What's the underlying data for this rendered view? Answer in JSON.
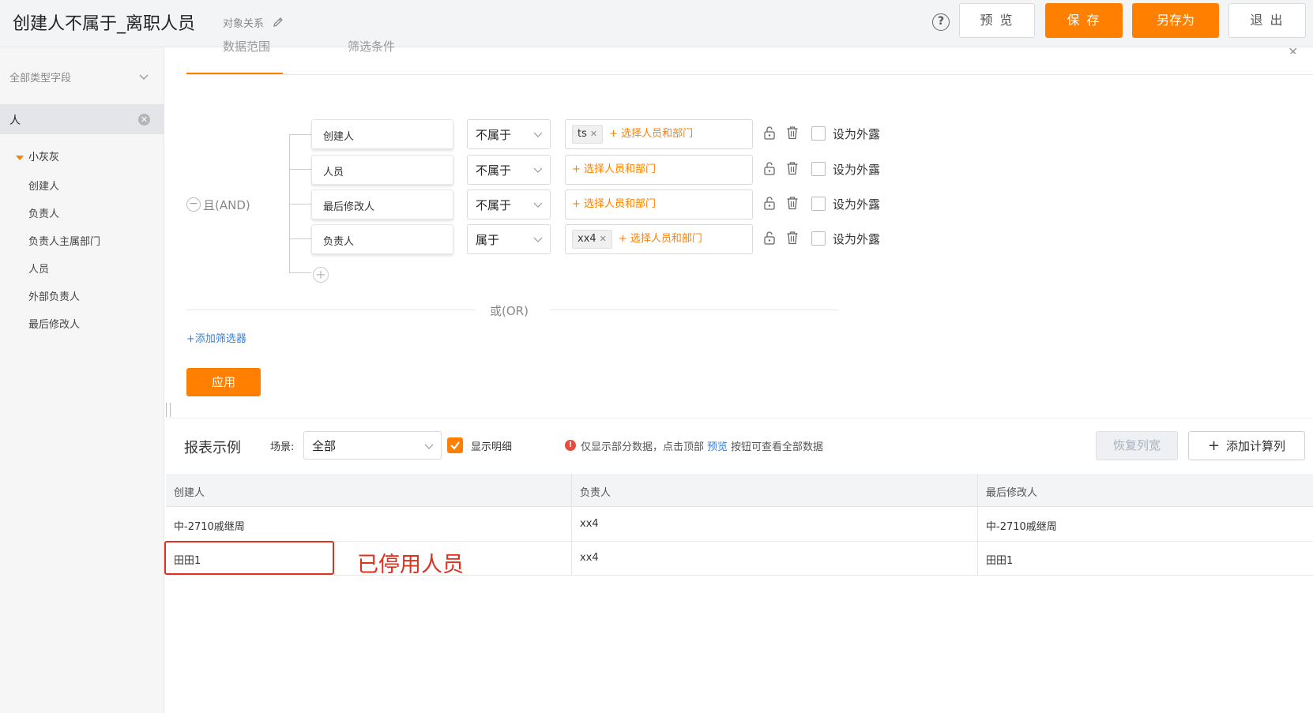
{
  "header": {
    "title": "创建人不属于_离职人员",
    "relation_label": "对象关系",
    "buttons": {
      "preview": "预 览",
      "save": "保 存",
      "save_as": "另存为",
      "exit": "退 出"
    },
    "help_icon": "?"
  },
  "sidebar": {
    "field_type": "全部类型字段",
    "search_value": "人",
    "tree": {
      "group": "小灰灰",
      "items": [
        "创建人",
        "负责人",
        "负责人主属部门",
        "人员",
        "外部负责人",
        "最后修改人"
      ]
    }
  },
  "filter": {
    "tabs": [
      "数据范围",
      "筛选条件"
    ],
    "logic_label": "且(AND)",
    "conditions": [
      {
        "field": "创建人",
        "operator": "不属于",
        "tags": [
          "ts"
        ],
        "add_label": "+ 选择人员和部门",
        "expose_label": "设为外露"
      },
      {
        "field": "人员",
        "operator": "不属于",
        "tags": [],
        "add_label": "+ 选择人员和部门",
        "expose_label": "设为外露"
      },
      {
        "field": "最后修改人",
        "operator": "不属于",
        "tags": [],
        "add_label": "+ 选择人员和部门",
        "expose_label": "设为外露"
      },
      {
        "field": "负责人",
        "operator": "属于",
        "tags": [
          "xx4"
        ],
        "add_label": "+ 选择人员和部门",
        "expose_label": "设为外露"
      }
    ],
    "or_label": "或(OR)",
    "add_filter": "+添加筛选器",
    "apply": "应用"
  },
  "report": {
    "title": "报表示例",
    "scene_label": "场景:",
    "scene_value": "全部",
    "show_detail": "显示明细",
    "notice_before": "仅显示部分数据，点击顶部",
    "notice_link": "预览",
    "notice_after": "按钮可查看全部数据",
    "restore_width": "恢复列宽",
    "add_calc": "添加计算列",
    "columns": [
      "创建人",
      "负责人",
      "最后修改人"
    ],
    "rows": [
      [
        "中-2710戚继周",
        "xx4",
        "中-2710戚继周"
      ],
      [
        "田田1",
        "xx4",
        "田田1"
      ]
    ]
  },
  "annotation": {
    "text": "已停用人员",
    "color": "#e0301e"
  },
  "colors": {
    "accent": "#ff8000",
    "link": "#3a7fd5"
  }
}
